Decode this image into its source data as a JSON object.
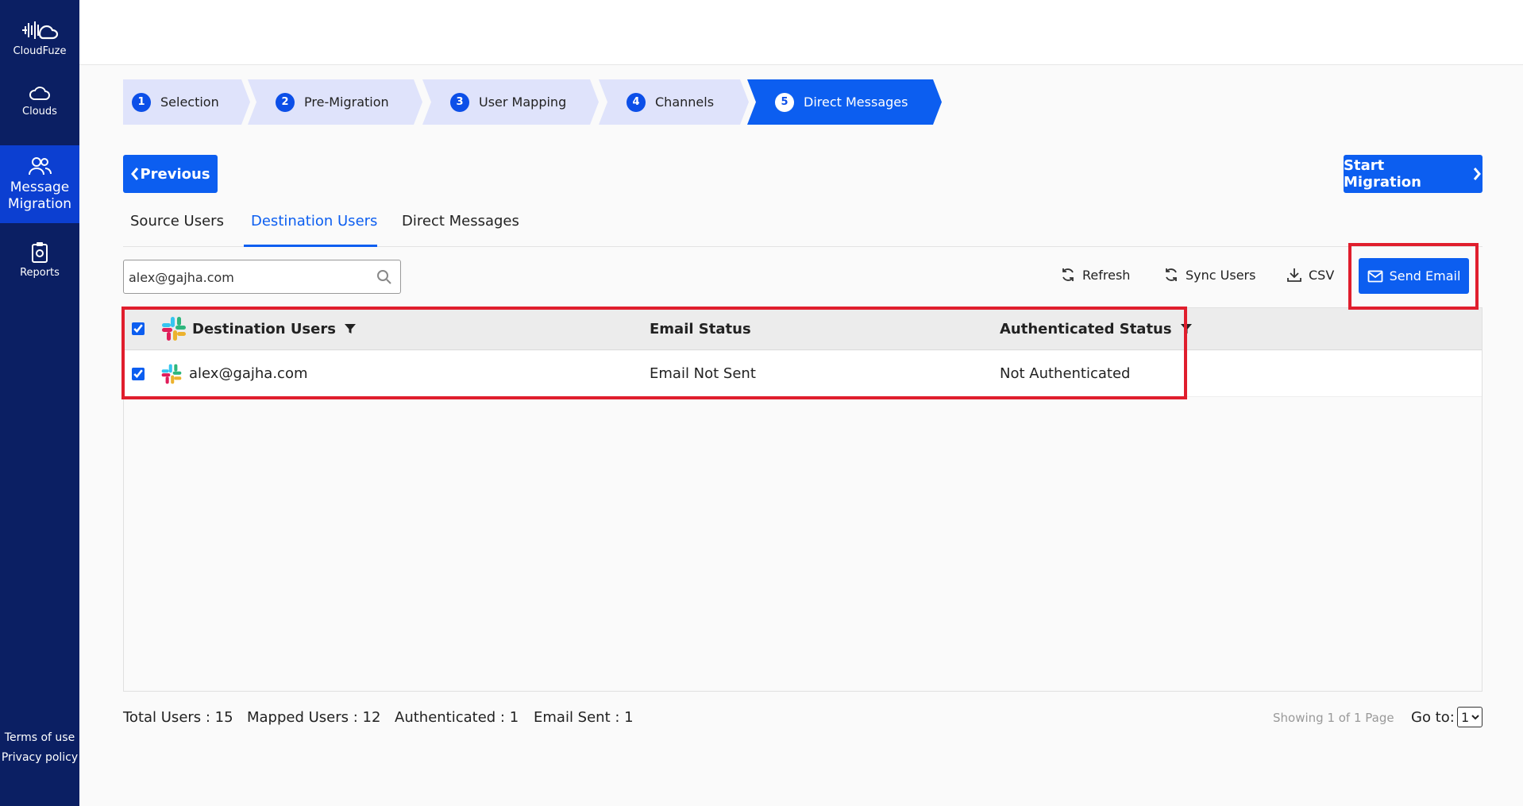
{
  "brand": {
    "name": "CloudFuze"
  },
  "sidebar": {
    "items": [
      {
        "label": "Clouds",
        "icon": "cloud-icon"
      },
      {
        "label": "Message Migration",
        "icon": "users-icon",
        "active": true
      },
      {
        "label": "Reports",
        "icon": "report-icon"
      }
    ],
    "footer": {
      "terms": "Terms of use",
      "privacy": "Privacy policy"
    }
  },
  "stepper": [
    {
      "num": "1",
      "label": "Selection"
    },
    {
      "num": "2",
      "label": "Pre-Migration"
    },
    {
      "num": "3",
      "label": "User Mapping"
    },
    {
      "num": "4",
      "label": "Channels"
    },
    {
      "num": "5",
      "label": "Direct Messages",
      "active": true
    }
  ],
  "actions": {
    "previous": "Previous",
    "start": "Start Migration"
  },
  "tabs": [
    {
      "label": "Source Users"
    },
    {
      "label": "Destination Users",
      "active": true
    },
    {
      "label": "Direct Messages"
    }
  ],
  "search": {
    "value": "alex@gajha.com"
  },
  "toolbar": {
    "refresh": "Refresh",
    "sync": "Sync Users",
    "csv": "CSV",
    "send_email": "Send Email"
  },
  "table": {
    "headers": {
      "user": "Destination Users",
      "email_status": "Email Status",
      "auth_status": "Authenticated Status"
    },
    "rows": [
      {
        "user": "alex@gajha.com",
        "email_status": "Email Not Sent",
        "auth_status": "Not Authenticated",
        "checked": true
      }
    ]
  },
  "footer": {
    "total": "Total Users : 15",
    "mapped": "Mapped Users : 12",
    "authenticated": "Authenticated : 1",
    "email_sent": "Email Sent : 1",
    "showing": "Showing 1 of 1 Page",
    "goto_label": "Go to:",
    "goto_value": "1"
  },
  "colors": {
    "sidebar": "#0b1f63",
    "accent": "#0c5ef0",
    "highlight": "#e01e2d",
    "step_inactive": "#dfe3fb"
  }
}
